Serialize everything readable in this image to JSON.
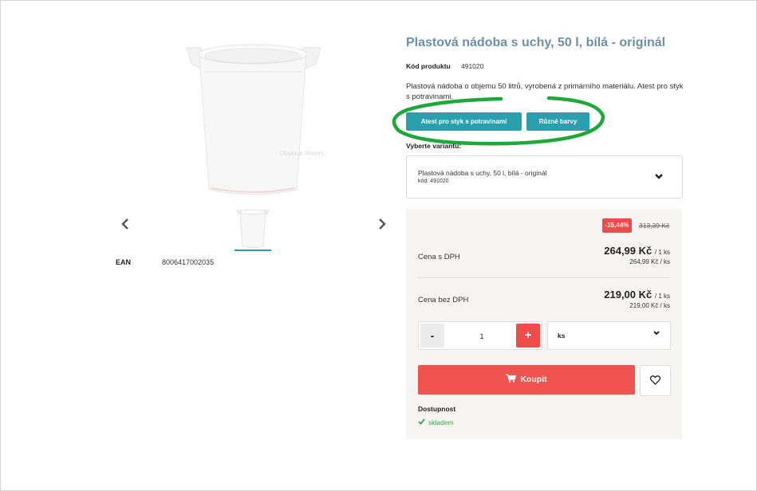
{
  "product": {
    "title": "Plastová nádoba s uchy, 50 l, bílá - originál",
    "code_label": "Kód produktu",
    "code_value": "491020",
    "description": "Plastová nádoba o objemu 50 litrů, vyrobená z primárního materiálu. Atest pro styk s potravinami.",
    "tags": [
      "Atest pro styk s potravinami",
      "Různé barvy"
    ],
    "ean_label": "EAN",
    "ean_value": "8006417002035",
    "watermark": "Obalové Materiály"
  },
  "variant": {
    "label": "Vyberte variantu:",
    "selected_name": "Plastová nádoba s uchy, 50 l, bílá - originál",
    "selected_code": "kód: 491020"
  },
  "price": {
    "discount": "-15,44%",
    "old_price": "313,39 Kč",
    "with_vat_label": "Cena s DPH",
    "with_vat_value": "264,99 Kč",
    "with_vat_unit": "/ 1 ks",
    "with_vat_sub": "264,99 Kč / ks",
    "without_vat_label": "Cena bez DPH",
    "without_vat_value": "219,00 Kč",
    "without_vat_unit": "/ 1 ks",
    "without_vat_sub": "219,00 Kč / ks"
  },
  "quantity": {
    "minus": "-",
    "value": "1",
    "plus": "+",
    "unit": "ks"
  },
  "buy_label": "Koupit",
  "availability": {
    "label": "Dostupnost",
    "status": "skladem"
  },
  "colors": {
    "accent": "#2a9fad",
    "buy": "#ef5350",
    "discount": "#ef4b4b",
    "title": "#6d8fa6",
    "highlight": "#1fa83a"
  },
  "icons": [
    "chevron-left-icon",
    "chevron-right-icon",
    "chevron-down-icon",
    "cart-icon",
    "heart-icon",
    "check-icon"
  ]
}
